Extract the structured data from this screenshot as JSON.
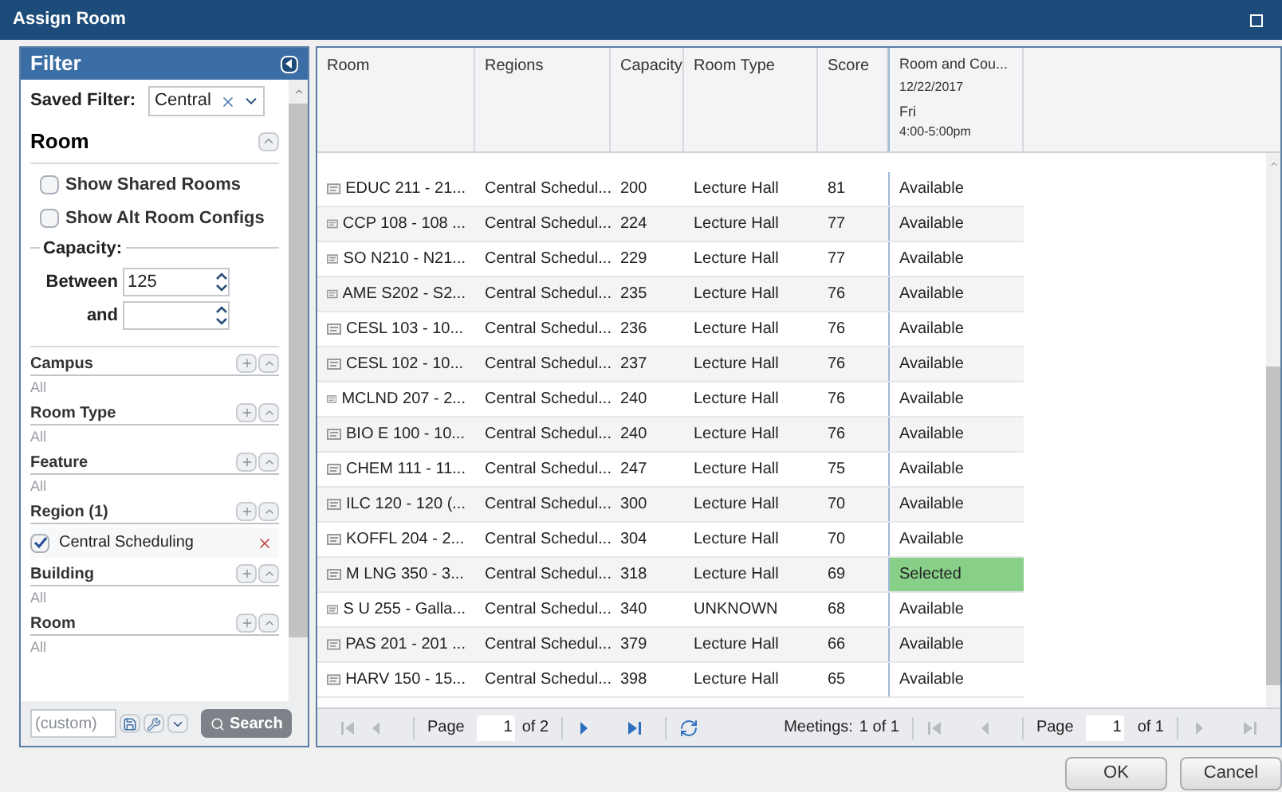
{
  "window": {
    "title": "Assign Room"
  },
  "filter": {
    "title": "Filter",
    "saved_filter_label": "Saved Filter:",
    "saved_filter_value": "Central",
    "room_section": {
      "title": "Room",
      "options": [
        {
          "label": "Show Shared Rooms",
          "checked": false
        },
        {
          "label": "Show Alt Room Configs",
          "checked": false
        }
      ],
      "capacity_label": "Capacity:",
      "between_label": "Between",
      "between_value": "125",
      "and_label": "and"
    },
    "sections": [
      {
        "title": "Campus",
        "summary": "All"
      },
      {
        "title": "Room Type",
        "summary": "All"
      },
      {
        "title": "Feature",
        "summary": "All"
      },
      {
        "title": "Region (1)",
        "items": [
          {
            "label": "Central Scheduling",
            "checked": true
          }
        ]
      },
      {
        "title": "Building",
        "summary": "All"
      },
      {
        "title": "Room",
        "summary": "All"
      }
    ],
    "custom_field": {
      "placeholder": "(custom)"
    },
    "search_button": "Search"
  },
  "table": {
    "columns": [
      "Room",
      "Regions",
      "Capacity",
      "Room Type",
      "Score"
    ],
    "meeting_column": {
      "title": "Room and Cou...",
      "date": "12/22/2017",
      "day": "Fri",
      "time": "4:00-5:00pm"
    },
    "rows": [
      {
        "room": "EDUC 211 - 21...",
        "region": "Central Schedul...",
        "capacity": "200",
        "room_type": "Lecture Hall",
        "score": "81",
        "status": "Available",
        "selected": false
      },
      {
        "room": "CCP 108 - 108 ...",
        "region": "Central Schedul...",
        "capacity": "224",
        "room_type": "Lecture Hall",
        "score": "77",
        "status": "Available",
        "selected": false
      },
      {
        "room": "SO N210 - N21...",
        "region": "Central Schedul...",
        "capacity": "229",
        "room_type": "Lecture Hall",
        "score": "77",
        "status": "Available",
        "selected": false
      },
      {
        "room": "AME S202 - S2...",
        "region": "Central Schedul...",
        "capacity": "235",
        "room_type": "Lecture Hall",
        "score": "76",
        "status": "Available",
        "selected": false
      },
      {
        "room": "CESL 103 - 10...",
        "region": "Central Schedul...",
        "capacity": "236",
        "room_type": "Lecture Hall",
        "score": "76",
        "status": "Available",
        "selected": false
      },
      {
        "room": "CESL 102 - 10...",
        "region": "Central Schedul...",
        "capacity": "237",
        "room_type": "Lecture Hall",
        "score": "76",
        "status": "Available",
        "selected": false
      },
      {
        "room": "MCLND 207 - 2...",
        "region": "Central Schedul...",
        "capacity": "240",
        "room_type": "Lecture Hall",
        "score": "76",
        "status": "Available",
        "selected": false
      },
      {
        "room": "BIO E 100 - 10...",
        "region": "Central Schedul...",
        "capacity": "240",
        "room_type": "Lecture Hall",
        "score": "76",
        "status": "Available",
        "selected": false
      },
      {
        "room": "CHEM 111 - 11...",
        "region": "Central Schedul...",
        "capacity": "247",
        "room_type": "Lecture Hall",
        "score": "75",
        "status": "Available",
        "selected": false
      },
      {
        "room": "ILC 120 - 120 (...",
        "region": "Central Schedul...",
        "capacity": "300",
        "room_type": "Lecture Hall",
        "score": "70",
        "status": "Available",
        "selected": false
      },
      {
        "room": "KOFFL 204 - 2...",
        "region": "Central Schedul...",
        "capacity": "304",
        "room_type": "Lecture Hall",
        "score": "70",
        "status": "Available",
        "selected": false
      },
      {
        "room": "M LNG 350 - 3...",
        "region": "Central Schedul...",
        "capacity": "318",
        "room_type": "Lecture Hall",
        "score": "69",
        "status": "Selected",
        "selected": true
      },
      {
        "room": "S U 255 - Galla...",
        "region": "Central Schedul...",
        "capacity": "340",
        "room_type": "UNKNOWN",
        "score": "68",
        "status": "Available",
        "selected": false
      },
      {
        "room": "PAS 201 - 201 ...",
        "region": "Central Schedul...",
        "capacity": "379",
        "room_type": "Lecture Hall",
        "score": "66",
        "status": "Available",
        "selected": false
      },
      {
        "room": "HARV 150 - 15...",
        "region": "Central Schedul...",
        "capacity": "398",
        "room_type": "Lecture Hall",
        "score": "65",
        "status": "Available",
        "selected": false
      }
    ]
  },
  "pager": {
    "page_label": "Page",
    "page_value": "1",
    "page_total": "of 2",
    "meetings_label": "Meetings:",
    "meetings_value": "1 of 1",
    "page2_label": "Page",
    "page2_value": "1",
    "page2_total": "of 1"
  },
  "buttons": [
    "OK",
    "Cancel"
  ]
}
